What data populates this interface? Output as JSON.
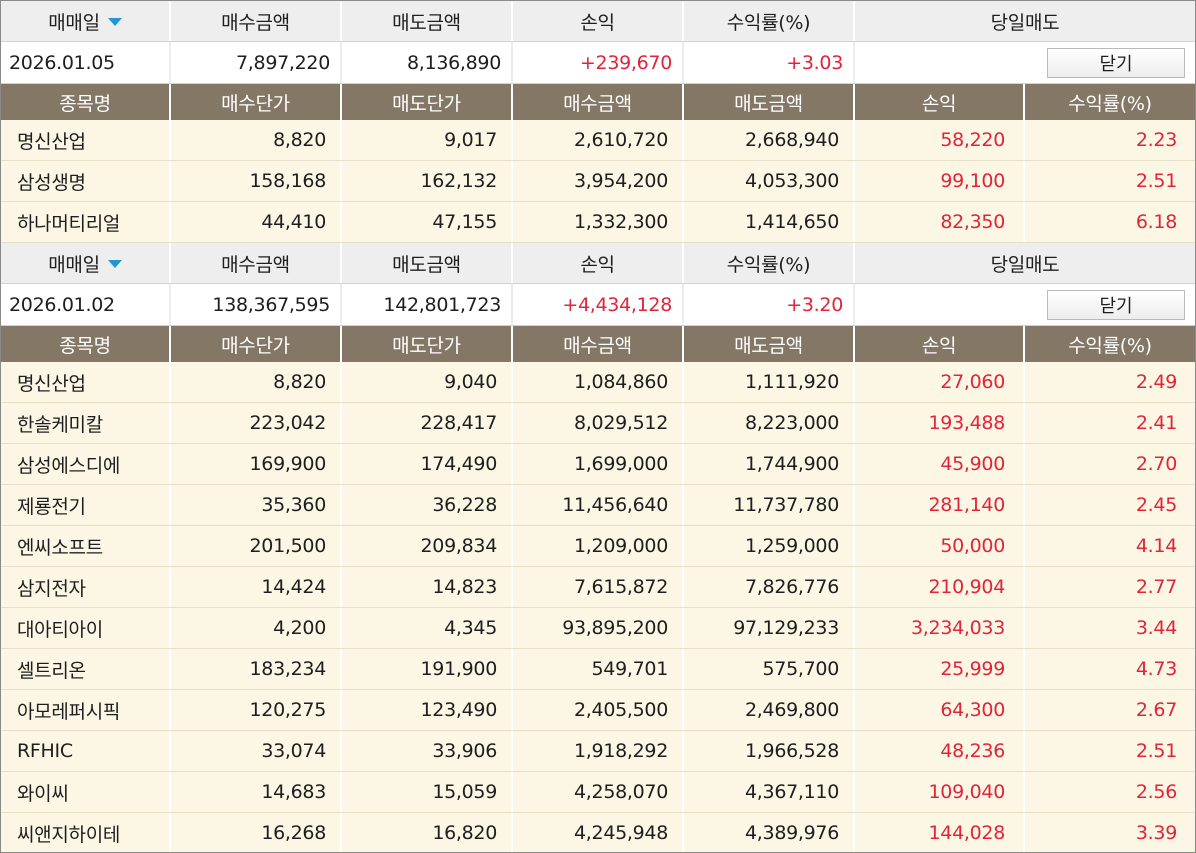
{
  "summary_headers": {
    "trade_date": "매매일",
    "buy_amount": "매수금액",
    "sell_amount": "매도금액",
    "profit": "손익",
    "return_rate": "수익률(%)",
    "same_day_sell": "당일매도"
  },
  "detail_headers": {
    "name": "종목명",
    "buy_price": "매수단가",
    "sell_price": "매도단가",
    "buy_amount": "매수금액",
    "sell_amount": "매도금액",
    "profit": "손익",
    "return_rate": "수익률(%)"
  },
  "close_label": "닫기",
  "colors": {
    "header_bg": "#857766",
    "row_bg": "#fcf7e4",
    "positive": "#e0243a",
    "sort_arrow": "#2196d4"
  },
  "groups": [
    {
      "summary": {
        "date": "2026.01.05",
        "buy_amount": "7,897,220",
        "sell_amount": "8,136,890",
        "profit": "+239,670",
        "return_rate": "+3.03"
      },
      "rows": [
        {
          "name": "명신산업",
          "buy_price": "8,820",
          "sell_price": "9,017",
          "buy_amount": "2,610,720",
          "sell_amount": "2,668,940",
          "profit": "58,220",
          "return_rate": "2.23"
        },
        {
          "name": "삼성생명",
          "buy_price": "158,168",
          "sell_price": "162,132",
          "buy_amount": "3,954,200",
          "sell_amount": "4,053,300",
          "profit": "99,100",
          "return_rate": "2.51"
        },
        {
          "name": "하나머티리얼",
          "buy_price": "44,410",
          "sell_price": "47,155",
          "buy_amount": "1,332,300",
          "sell_amount": "1,414,650",
          "profit": "82,350",
          "return_rate": "6.18"
        }
      ]
    },
    {
      "summary": {
        "date": "2026.01.02",
        "buy_amount": "138,367,595",
        "sell_amount": "142,801,723",
        "profit": "+4,434,128",
        "return_rate": "+3.20"
      },
      "rows": [
        {
          "name": "명신산업",
          "buy_price": "8,820",
          "sell_price": "9,040",
          "buy_amount": "1,084,860",
          "sell_amount": "1,111,920",
          "profit": "27,060",
          "return_rate": "2.49"
        },
        {
          "name": "한솔케미칼",
          "buy_price": "223,042",
          "sell_price": "228,417",
          "buy_amount": "8,029,512",
          "sell_amount": "8,223,000",
          "profit": "193,488",
          "return_rate": "2.41"
        },
        {
          "name": "삼성에스디에",
          "buy_price": "169,900",
          "sell_price": "174,490",
          "buy_amount": "1,699,000",
          "sell_amount": "1,744,900",
          "profit": "45,900",
          "return_rate": "2.70"
        },
        {
          "name": "제룡전기",
          "buy_price": "35,360",
          "sell_price": "36,228",
          "buy_amount": "11,456,640",
          "sell_amount": "11,737,780",
          "profit": "281,140",
          "return_rate": "2.45"
        },
        {
          "name": "엔씨소프트",
          "buy_price": "201,500",
          "sell_price": "209,834",
          "buy_amount": "1,209,000",
          "sell_amount": "1,259,000",
          "profit": "50,000",
          "return_rate": "4.14"
        },
        {
          "name": "삼지전자",
          "buy_price": "14,424",
          "sell_price": "14,823",
          "buy_amount": "7,615,872",
          "sell_amount": "7,826,776",
          "profit": "210,904",
          "return_rate": "2.77"
        },
        {
          "name": "대아티아이",
          "buy_price": "4,200",
          "sell_price": "4,345",
          "buy_amount": "93,895,200",
          "sell_amount": "97,129,233",
          "profit": "3,234,033",
          "return_rate": "3.44"
        },
        {
          "name": "셀트리온",
          "buy_price": "183,234",
          "sell_price": "191,900",
          "buy_amount": "549,701",
          "sell_amount": "575,700",
          "profit": "25,999",
          "return_rate": "4.73"
        },
        {
          "name": "아모레퍼시픽",
          "buy_price": "120,275",
          "sell_price": "123,490",
          "buy_amount": "2,405,500",
          "sell_amount": "2,469,800",
          "profit": "64,300",
          "return_rate": "2.67"
        },
        {
          "name": "RFHIC",
          "buy_price": "33,074",
          "sell_price": "33,906",
          "buy_amount": "1,918,292",
          "sell_amount": "1,966,528",
          "profit": "48,236",
          "return_rate": "2.51"
        },
        {
          "name": "와이씨",
          "buy_price": "14,683",
          "sell_price": "15,059",
          "buy_amount": "4,258,070",
          "sell_amount": "4,367,110",
          "profit": "109,040",
          "return_rate": "2.56"
        },
        {
          "name": "씨앤지하이테",
          "buy_price": "16,268",
          "sell_price": "16,820",
          "buy_amount": "4,245,948",
          "sell_amount": "4,389,976",
          "profit": "144,028",
          "return_rate": "3.39"
        }
      ]
    }
  ]
}
